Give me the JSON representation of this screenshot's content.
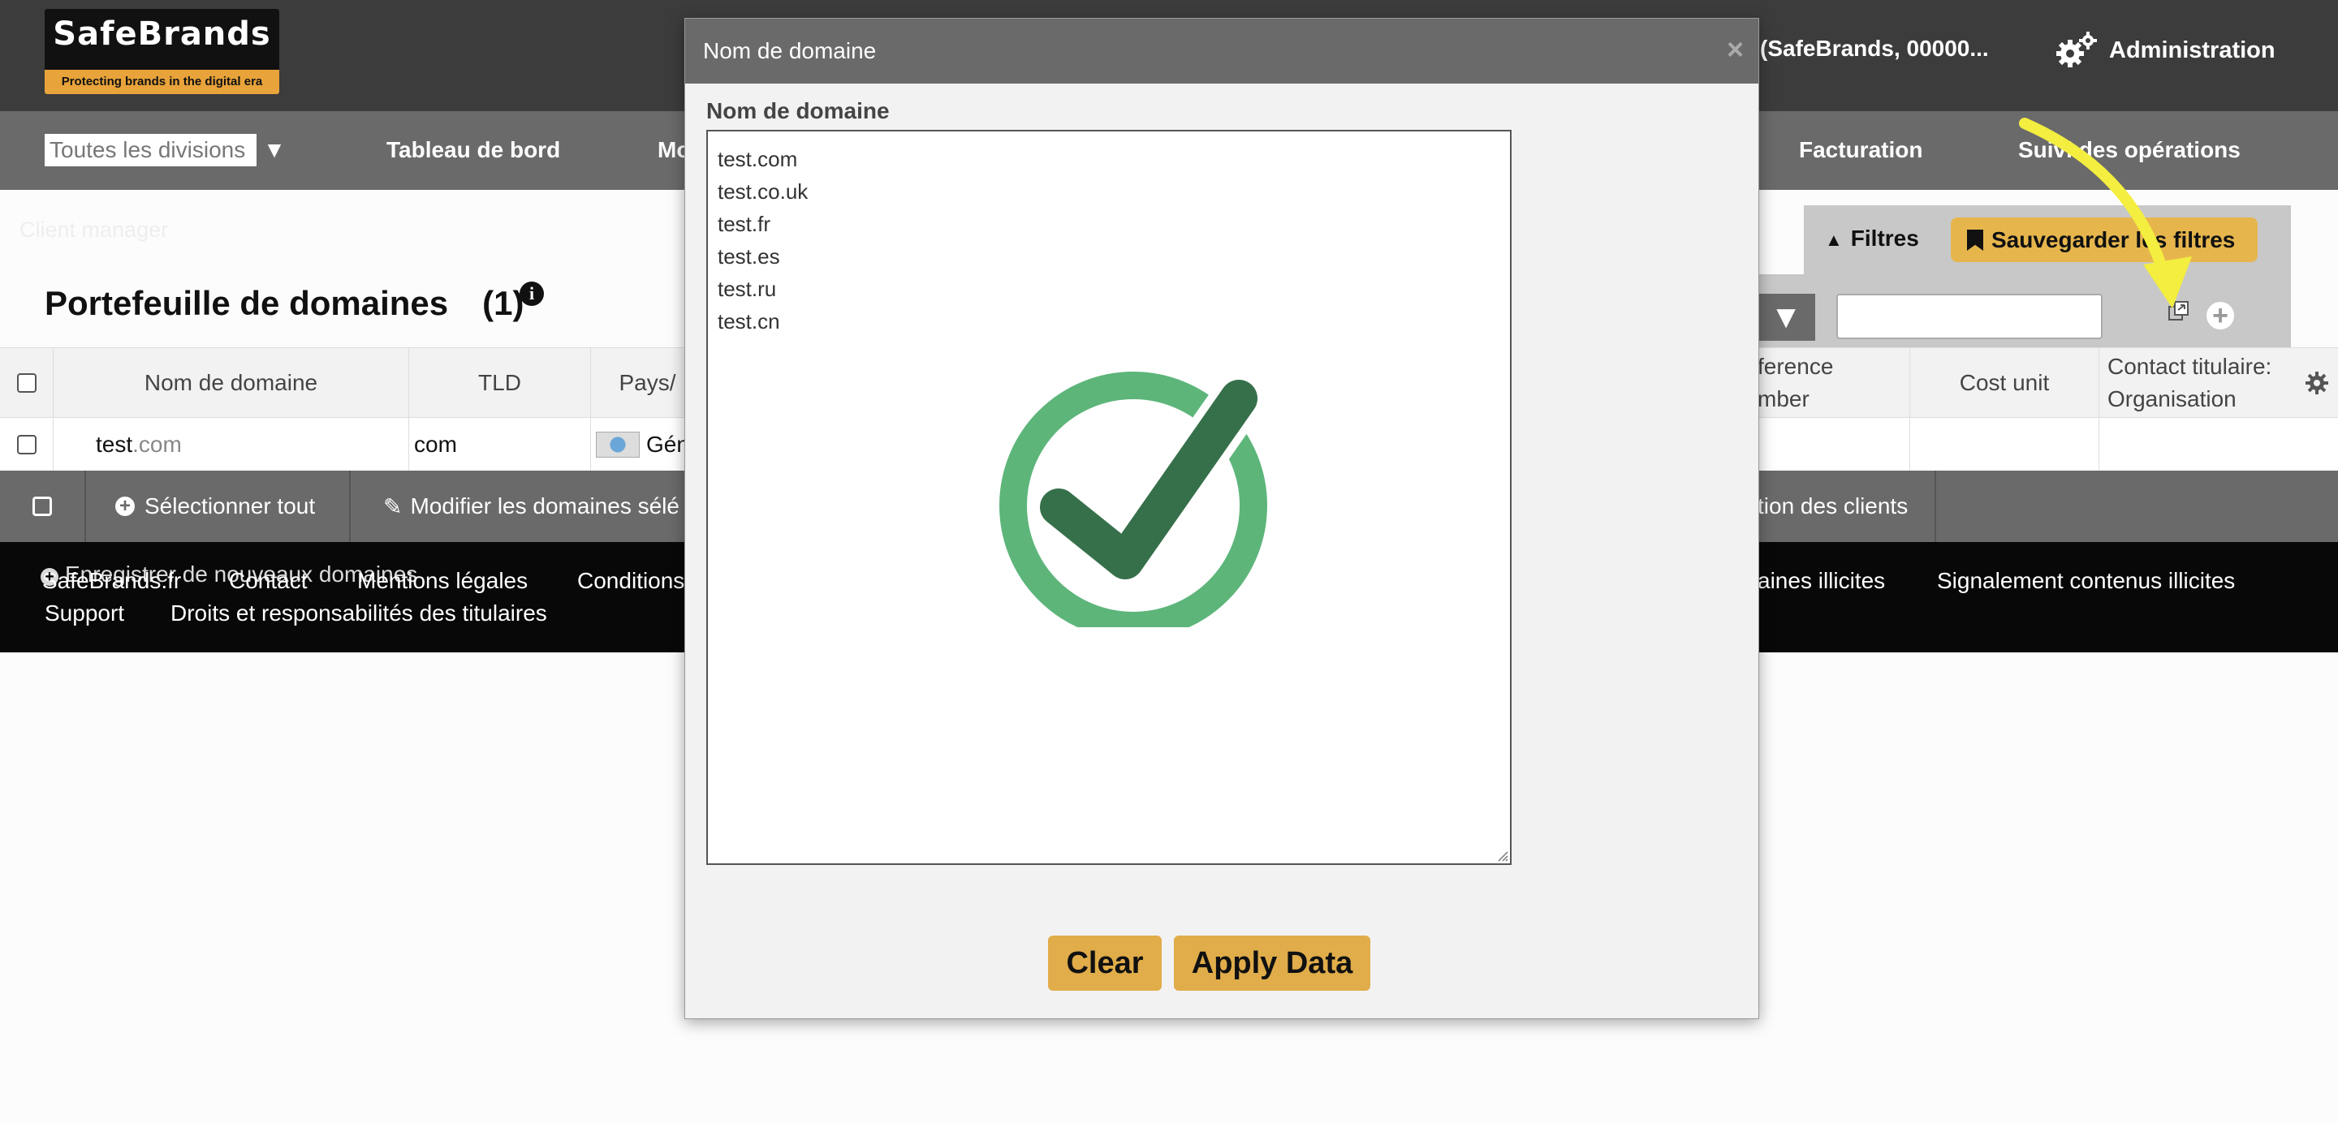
{
  "header": {
    "logo_name": "SafeBrands",
    "logo_tagline": "Protecting brands in the digital era",
    "user_label": "(SafeBrands, 00000...",
    "admin_label": "Administration"
  },
  "nav": {
    "division_value": "Toutes les divisions",
    "items": [
      "Tableau de bord",
      "Mo",
      "Facturation",
      "Suivi des opérations"
    ]
  },
  "breadcrumb": "Client manager",
  "filters": {
    "toggle_label": "Filtres",
    "save_label": "Sauvegarder les filtres"
  },
  "page": {
    "title": "Portefeuille de domaines",
    "count": "(1)"
  },
  "table": {
    "headers": [
      "Nom de domaine",
      "TLD",
      "Pays/",
      "ference\nmber",
      "Cost unit",
      "Contact titulaire:\nOrganisation"
    ],
    "row": {
      "domain_name": "test",
      "domain_tld": ".com",
      "tld": "com",
      "country": "Géné"
    }
  },
  "actions": {
    "select_all": "Sélectionner tout",
    "modify": "Modifier les domaines sélé",
    "clients": "tion des clients"
  },
  "footer": {
    "register_new": "Enregistrer de nouveaux domaines",
    "links": [
      "SafeBrands.fr",
      "Contact",
      "Mentions légales",
      "Conditions",
      "aines illicites",
      "Signalement contenus illicites",
      "Support",
      "Droits et responsabilités des titulaires"
    ]
  },
  "modal": {
    "title": "Nom de domaine",
    "close": "×",
    "field_label": "Nom de domaine",
    "textarea_lines": [
      "test.com",
      "test.co.uk",
      "test.fr",
      "test.es",
      "test.ru",
      "test.cn"
    ],
    "clear_label": "Clear",
    "apply_label": "Apply Data"
  },
  "colors": {
    "header_bg": "#3c3c3c",
    "nav_bg": "#6a6a6a",
    "accent": "#e0ad4a",
    "success_light": "#5db57a",
    "success_dark": "#36704a",
    "annotation": "#f3ee3f"
  }
}
